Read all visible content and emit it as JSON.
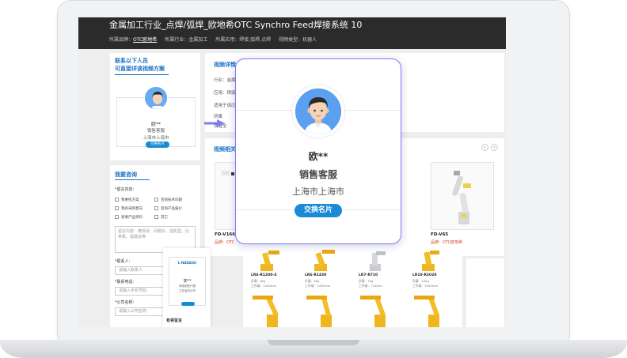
{
  "header": {
    "title": "金属加工行业_点焊/弧焊_欧地希OTC Synchro Feed焊接系统 10",
    "crumbs": {
      "brand_label": "所属品牌：",
      "brand_value": "OTC欧地希",
      "industry": "所属行业：金属加工",
      "application": "所属应用：焊接,弧焊,点焊",
      "video_type": "视频类型：机器人"
    }
  },
  "contact": {
    "heading_line1": "联系以下人员",
    "heading_line2": "可直接详谈视频方案",
    "name": "欧**",
    "role": "销售客服",
    "location": "上海市上海市",
    "button": "交换名片"
  },
  "consult": {
    "heading": "我要咨询",
    "need_label": "*留言内容：",
    "options": [
      "我要找方案",
      "咨询技术问题",
      "我有采购意向",
      "咨询产品报价",
      "索要产品资料",
      "其它"
    ],
    "message_placeholder": "留言内容：微现状、问题价、选机型、比参数、提建议等",
    "contact_label": "*联系人：",
    "contact_placeholder": "请输入联系人",
    "phone_label": "*联系电话：",
    "phone_placeholder": "请输入手机号码",
    "company_label": "*公司名称：",
    "company_placeholder": "请输入公司名称"
  },
  "detail": {
    "heading": "视频详情",
    "rows": [
      "行业：金属",
      "应用：焊接",
      "适用于该应",
      "所属",
      "我看全"
    ]
  },
  "video": {
    "heading": "视频相关",
    "prev": "‹",
    "next": "›",
    "items": [
      {
        "title": "FD-V166",
        "brand": "品牌：OTC"
      },
      {
        "title": "FD-V65",
        "brand": "品牌：OTC欧地希"
      }
    ]
  },
  "card2": {
    "logo": "L-NAKAGU",
    "name": "安**",
    "sub1": "网络销售代理",
    "sub2": "江苏省苏州市",
    "footer": "有将留言"
  },
  "robots": [
    {
      "name": "LR6-R1200-4",
      "load": "负载：6kg",
      "reach": "工作域：1200mm"
    },
    {
      "name": "LR6-R1430",
      "load": "负载：6kg",
      "reach": "工作域：1430mm"
    },
    {
      "name": "LR7-R710",
      "load": "负载：7kg",
      "reach": "工作域：710mm"
    },
    {
      "name": "LR10-R2020",
      "load": "负载：10kg",
      "reach": "工作域：2020mm"
    }
  ],
  "popup": {
    "name": "欧**",
    "role": "销售客服",
    "location": "上海市上海市",
    "button": "交换名片"
  },
  "colors": {
    "accent": "#1a6fc4",
    "button": "#1a8ad6",
    "header_bg": "#2b2b2b",
    "popup_border": "#7d7ff0",
    "brand_red": "#d9432f"
  }
}
